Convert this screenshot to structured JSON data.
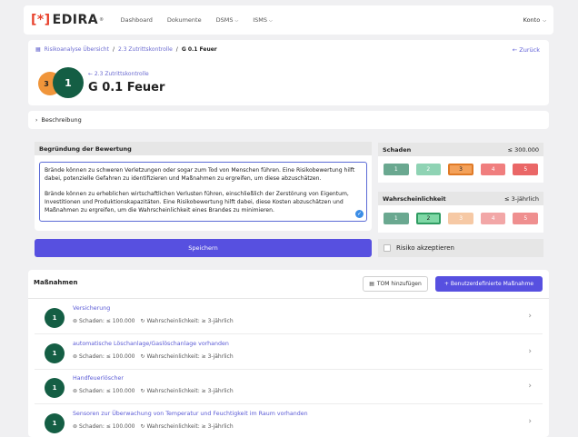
{
  "topbar": {
    "logo_bracket": "[*]",
    "logo_text": "EDIRA",
    "logo_reg": "®",
    "nav": [
      "Dashboard",
      "Dokumente",
      "DSMS",
      "ISMS"
    ],
    "account": "Konto"
  },
  "breadcrumb": [
    "Risikoanalyse Übersicht",
    "2.3 Zutrittskontrolle",
    "G 0.1 Feuer"
  ],
  "back_label": "← Zurück",
  "header": {
    "back_small": "← 2.3 Zutrittskontrolle",
    "title": "G 0.1 Feuer",
    "risk_before": "3",
    "risk_after": "1"
  },
  "description_toggle": "Beschreibung",
  "bewertung": {
    "heading": "Begründung der Bewertung",
    "paragraph1": "Brände können zu schweren Verletzungen oder sogar zum Tod von Menschen führen. Eine Risikobewertung hilft dabei, potenzielle Gefahren zu identifizieren und Maßnahmen zu ergreifen, um diese abzuschätzen.",
    "paragraph2": "Brände können zu erheblichen wirtschaftlichen Verlusten führen, einschließlich der Zerstörung von Eigentum, Investitionen und Produktionskapazitäten. Eine Risikobewertung hilft dabei, diese Kosten abzuschätzen und Maßnahmen zu ergreifen, um die Wahrscheinlichkeit eines Brandes zu minimieren."
  },
  "save_label": "Speichern",
  "schaden": {
    "label": "Schaden",
    "value": "≤ 300.000",
    "levels": [
      "1",
      "2",
      "3",
      "4",
      "5"
    ],
    "selected": 3
  },
  "wahrscheinlichkeit": {
    "label": "Wahrscheinlichkeit",
    "value": "≤ 3-jährlich",
    "levels": [
      "1",
      "2",
      "3",
      "4",
      "5"
    ],
    "selected": 2
  },
  "scale_colors": {
    "dark": [
      "#6aa890",
      "#8fd3b4",
      "#f3a15a",
      "#f07e7e",
      "#ea6767"
    ],
    "light": [
      "#6aa890",
      "#7fd8a6",
      "#f6c9a5",
      "#f2a7a7",
      "#ef8f8f"
    ]
  },
  "risk_accept_label": "Risiko akzeptieren",
  "massnahmen": {
    "heading": "Maßnahmen",
    "tom_button": "TOM hinzufügen",
    "custom_button": "+ Benutzerdefinierte Maßnahme",
    "items": [
      {
        "num": "1",
        "title": "Versicherung",
        "schaden": "Schaden: ≤ 100.000",
        "wahrsch": "Wahrscheinlichkeit: ≥ 3-jährlich"
      },
      {
        "num": "1",
        "title": "automatische Löschanlage/Gaslöschanlage vorhanden",
        "schaden": "Schaden: ≤ 100.000",
        "wahrsch": "Wahrscheinlichkeit: ≥ 3-jährlich"
      },
      {
        "num": "1",
        "title": "Handfeuerlöscher",
        "schaden": "Schaden: ≤ 100.000",
        "wahrsch": "Wahrscheinlichkeit: ≥ 3-jährlich"
      },
      {
        "num": "1",
        "title": "Sensoren zur Überwachung von Temperatur und Feuchtigkeit im Raum vorhanden",
        "schaden": "Schaden: ≤ 100.000",
        "wahrsch": "Wahrscheinlichkeit: ≥ 3-jährlich"
      }
    ]
  }
}
